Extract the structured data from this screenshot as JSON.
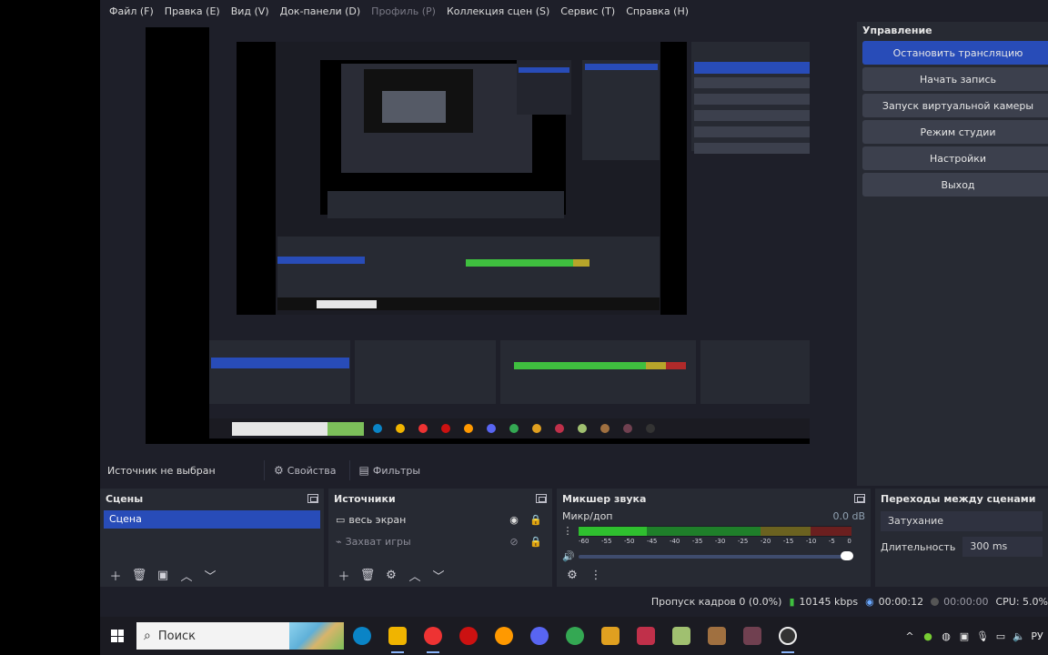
{
  "menu": [
    "Файл (F)",
    "Правка (E)",
    "Вид (V)",
    "Док-панели (D)",
    "Профиль (P)",
    "Коллекция сцен (S)",
    "Сервис (T)",
    "Справка (H)"
  ],
  "controls": {
    "title": "Управление",
    "buttons": [
      "Остановить трансляцию",
      "Начать запись",
      "Запуск виртуальной камеры",
      "Режим студии",
      "Настройки",
      "Выход"
    ]
  },
  "source_toolbar": {
    "label": "Источник не выбран",
    "properties": "Свойства",
    "filters": "Фильтры"
  },
  "scenes": {
    "title": "Сцены",
    "items": [
      "Сцена"
    ]
  },
  "sources": {
    "title": "Источники",
    "items": [
      {
        "name": "весь экран",
        "visible": true,
        "locked": true
      },
      {
        "name": "Захват игры",
        "visible": false,
        "locked": true
      }
    ]
  },
  "mixer": {
    "title": "Микшер звука",
    "track": "Микр/доп",
    "db": "0.0 dB",
    "scale": [
      "-60",
      "-55",
      "-50",
      "-45",
      "-40",
      "-35",
      "-30",
      "-25",
      "-20",
      "-15",
      "-10",
      "-5",
      "0"
    ]
  },
  "transitions": {
    "title": "Переходы между сценами",
    "type": "Затухание",
    "duration_label": "Длительность",
    "duration": "300 ms"
  },
  "status": {
    "dropped": "Пропуск кадров 0 (0.0%)",
    "bitrate": "10145 kbps",
    "live_time": "00:00:12",
    "rec_time": "00:00:00",
    "cpu": "CPU: 5.0%"
  },
  "taskbar": {
    "search_placeholder": "Поиск"
  },
  "colors": {
    "accent_blue": "#284cb8",
    "dock_bg": "#272a33",
    "app_bg": "#1e1f29",
    "meter_green": "#3fbf3f",
    "meter_yellow": "#b7a52a",
    "meter_red": "#b02a2a"
  }
}
